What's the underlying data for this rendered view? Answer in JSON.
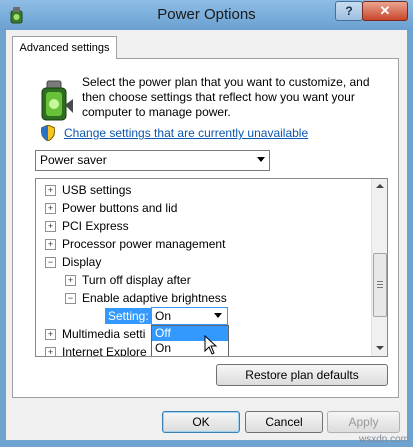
{
  "window": {
    "title": "Power Options",
    "help": "?",
    "close": "✕"
  },
  "tab": {
    "label": "Advanced settings"
  },
  "intro": "Select the power plan that you want to customize, and then choose settings that reflect how you want your computer to manage power.",
  "change_link": "Change settings that are currently unavailable",
  "plan": {
    "selected": "Power saver"
  },
  "tree": {
    "items": [
      {
        "label": "USB settings",
        "expander": "+"
      },
      {
        "label": "Power buttons and lid",
        "expander": "+"
      },
      {
        "label": "PCI Express",
        "expander": "+"
      },
      {
        "label": "Processor power management",
        "expander": "+"
      },
      {
        "label": "Display",
        "expander": "−"
      },
      {
        "label": "Turn off display after",
        "expander": "+"
      },
      {
        "label": "Enable adaptive brightness",
        "expander": "−"
      },
      {
        "label": "Multimedia setti",
        "expander": "+"
      },
      {
        "label": "Internet Explore",
        "expander": "+"
      }
    ],
    "setting_label": "Setting:",
    "setting_value": "On",
    "options": [
      "Off",
      "On"
    ],
    "highlighted_option": "Off"
  },
  "buttons": {
    "restore": "Restore plan defaults",
    "ok": "OK",
    "cancel": "Cancel",
    "apply": "Apply"
  },
  "watermark": "wsxdn.com"
}
